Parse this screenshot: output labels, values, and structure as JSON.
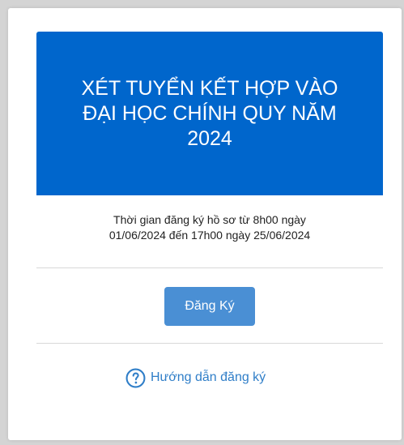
{
  "card": {
    "title": "XÉT TUYỂN KẾT HỢP VÀO\nĐẠI HỌC CHÍNH QUY NĂM\n2024",
    "period_text": "Thời gian đăng ký hồ sơ từ 8h00 ngày\n01/06/2024 đến 17h00 ngày 25/06/2024",
    "register_button_label": "Đăng Ký",
    "guide_link_label": "Hướng dẫn đăng ký",
    "guide_icon": "question-circle-icon"
  },
  "colors": {
    "banner": "#0066cc",
    "button": "#4a8fd4",
    "link": "#2f7ec8"
  }
}
